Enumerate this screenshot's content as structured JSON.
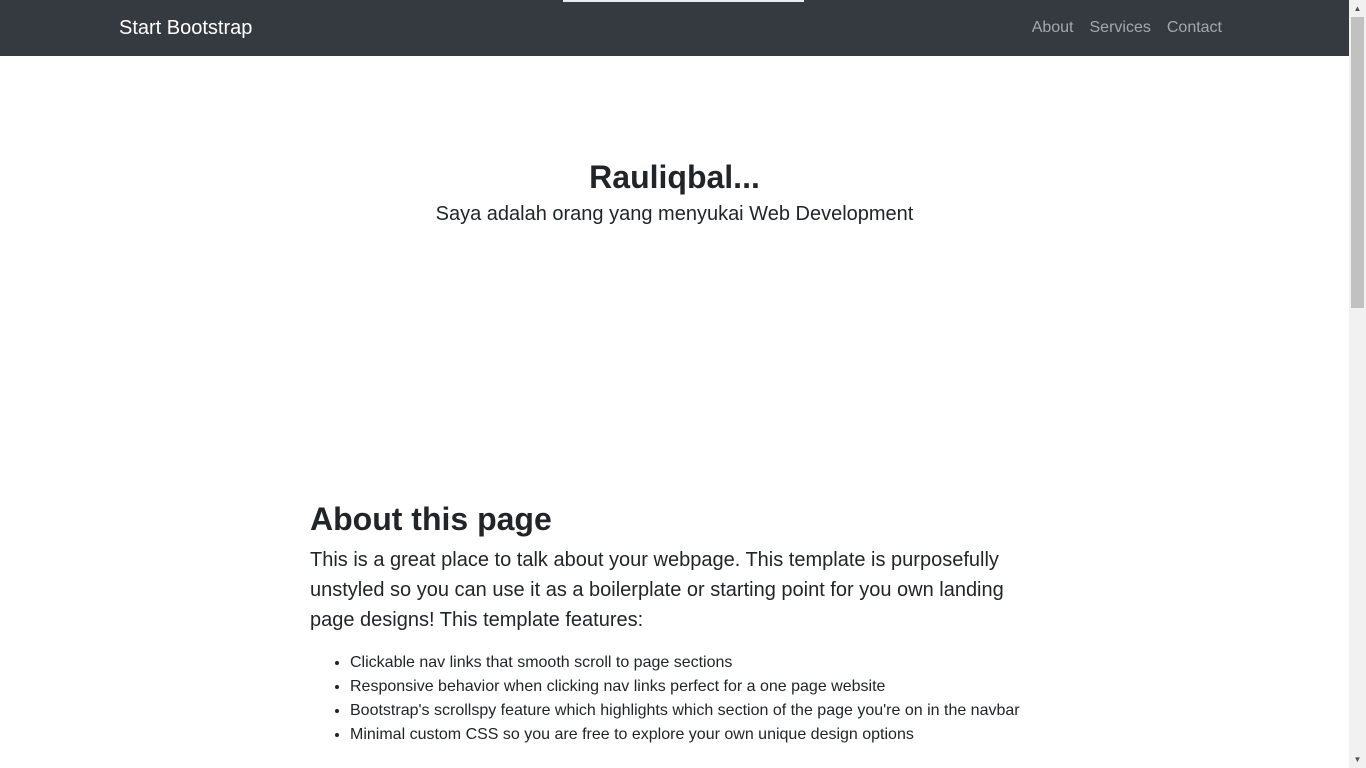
{
  "navbar": {
    "brand": "Start Bootstrap",
    "links": [
      "About",
      "Services",
      "Contact"
    ]
  },
  "hero": {
    "title": "Rauliqbal...",
    "lead": "Saya adalah orang yang menyukai Web Development"
  },
  "about": {
    "title": "About this page",
    "lead": "This is a great place to talk about your webpage. This template is purposefully unstyled so you can use it as a boilerplate or starting point for you own landing page designs! This template features:",
    "features": [
      "Clickable nav links that smooth scroll to page sections",
      "Responsive behavior when clicking nav links perfect for a one page website",
      "Bootstrap's scrollspy feature which highlights which section of the page you're on in the navbar",
      "Minimal custom CSS so you are free to explore your own unique design options"
    ]
  },
  "scrollbar": {
    "up_icon": "triangle-up-icon",
    "down_icon": "triangle-down-icon"
  },
  "colors": {
    "navbar_bg": "#343a40",
    "text": "#212529",
    "nav_link": "#9a9da0"
  }
}
